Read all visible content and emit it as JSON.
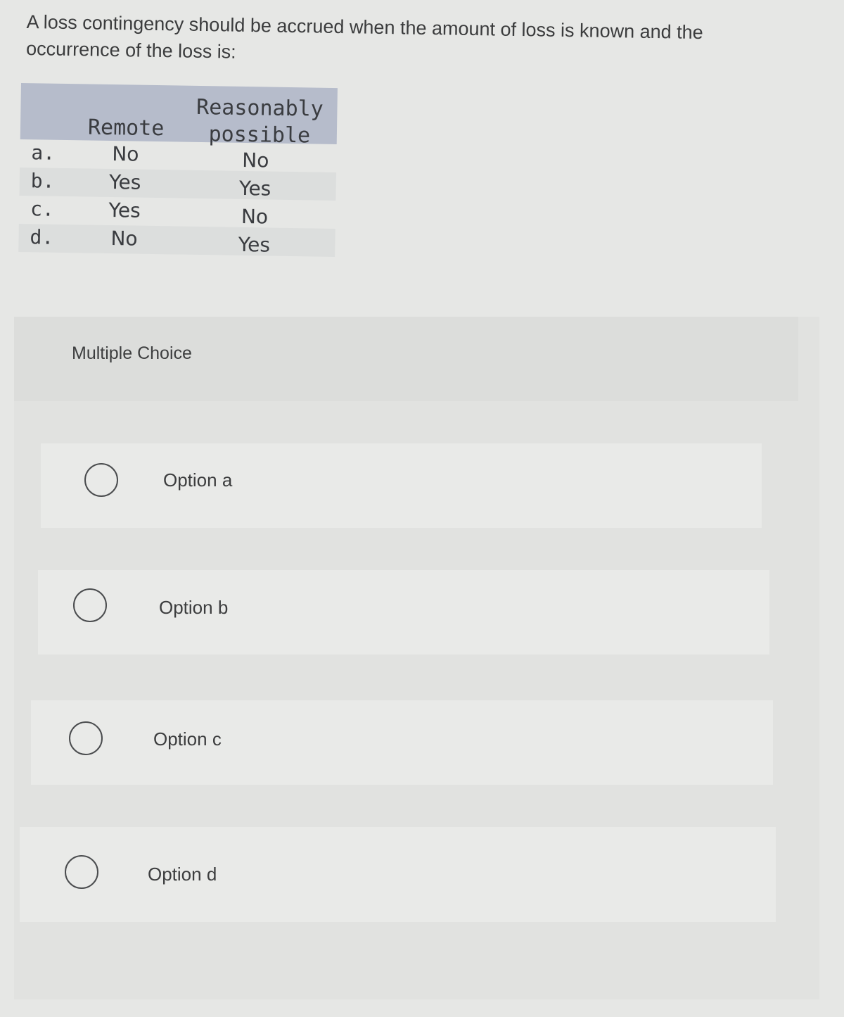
{
  "question": {
    "text": "A loss contingency should be accrued when the amount of loss is known and the occurrence of the loss is:"
  },
  "table": {
    "headers": {
      "remote": "Remote",
      "reasonably_possible_line1": "Reasonably",
      "reasonably_possible_line2": "possible"
    },
    "rows": [
      {
        "label": "a.",
        "remote": "No",
        "reasonably_possible": "No"
      },
      {
        "label": "b.",
        "remote": "Yes",
        "reasonably_possible": "Yes"
      },
      {
        "label": "c.",
        "remote": "Yes",
        "reasonably_possible": "No"
      },
      {
        "label": "d.",
        "remote": "No",
        "reasonably_possible": "Yes"
      }
    ]
  },
  "multiple_choice": {
    "title": "Multiple Choice",
    "options": [
      {
        "label": "Option a",
        "selected": false,
        "icon": "radio-unchecked-icon"
      },
      {
        "label": "Option b",
        "selected": false,
        "icon": "radio-unchecked-icon"
      },
      {
        "label": "Option c",
        "selected": false,
        "icon": "radio-unchecked-icon"
      },
      {
        "label": "Option d",
        "selected": false,
        "icon": "radio-unchecked-icon"
      }
    ]
  }
}
